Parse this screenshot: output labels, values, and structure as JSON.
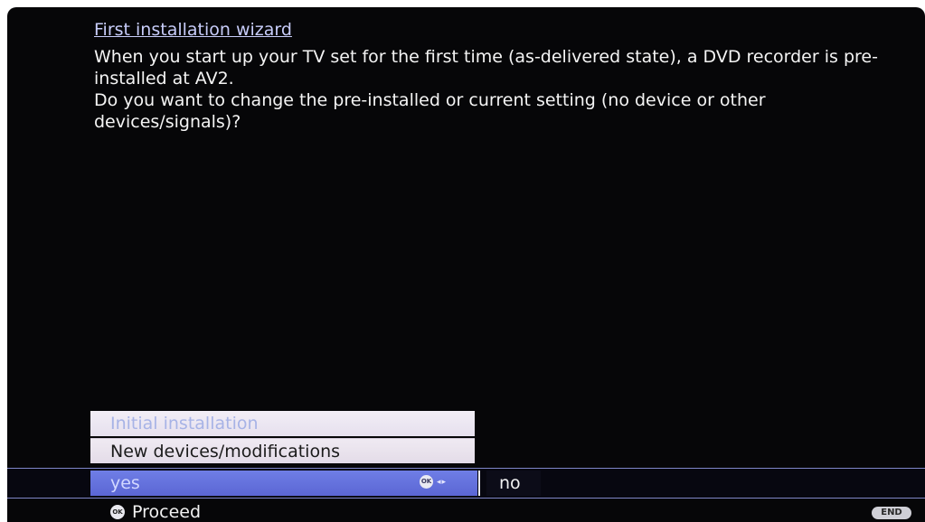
{
  "wizard": {
    "title": "First installation wizard",
    "message": [
      "When you start up your TV set for the first time (as-delivered state), a DVD recorder is pre-installed at AV2.",
      "Do you want to change the pre-installed or current setting (no device or other devices/signals)?"
    ]
  },
  "menu": {
    "items": [
      {
        "label": "Initial installation"
      },
      {
        "label": "New devices/modifications"
      }
    ]
  },
  "selection": {
    "options": [
      {
        "label": "yes",
        "selected": true
      },
      {
        "label": "no",
        "selected": false
      }
    ],
    "hint_icon": "ok-button-icon",
    "hint_arrows": "left-right-arrow-icon"
  },
  "footer": {
    "ok_icon_text": "OK",
    "proceed_label": "Proceed",
    "end_label": "END"
  },
  "colors": {
    "background": "#060608",
    "title": "#c8cdfa",
    "selected_option": "#5b66d4",
    "menu_item": "#e8e2ee"
  }
}
